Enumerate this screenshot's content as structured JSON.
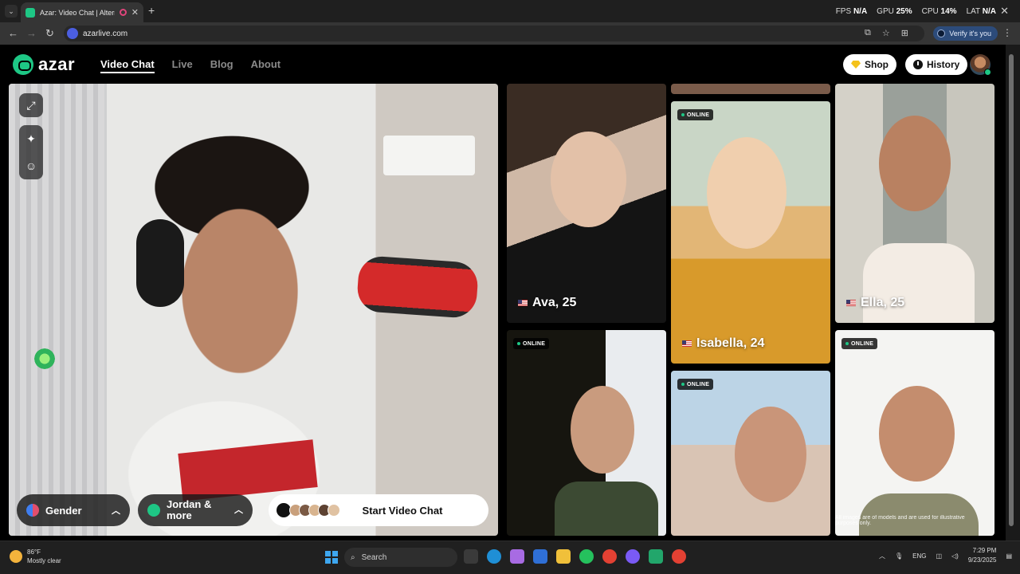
{
  "browser": {
    "tab_title": "Azar: Video Chat | Alternati",
    "url": "azarlive.com",
    "new_tab_symbol": "+",
    "verify_label": "Verify it's you",
    "perf": {
      "fps_label": "FPS",
      "fps_value": "N/A",
      "gpu_label": "GPU",
      "gpu_value": "25%",
      "cpu_label": "CPU",
      "cpu_value": "14%",
      "lat_label": "LAT",
      "lat_value": "N/A"
    }
  },
  "site": {
    "logo_text": "azar",
    "nav": [
      "Video Chat",
      "Live",
      "Blog",
      "About"
    ],
    "shop_label": "Shop",
    "history_label": "History"
  },
  "controls": {
    "gender_label": "Gender",
    "region_label": "Jordan & more",
    "start_label": "Start Video Chat"
  },
  "gallery": {
    "online_label": "ONLINE",
    "cards": [
      {
        "name": "Ava, 25",
        "online": false
      },
      {
        "name": "Isabella, 24",
        "online": true
      },
      {
        "name": "Ella, 25",
        "online": false
      },
      {
        "name": "",
        "online": true
      },
      {
        "name": "",
        "online": true
      },
      {
        "name": "",
        "online": true
      }
    ],
    "disclaimer": "All images are of models and are used for illustrative purposes only."
  },
  "taskbar": {
    "temp": "86°F",
    "weather": "Mostly clear",
    "search_placeholder": "Search",
    "lang": "ENG",
    "time": "7:29 PM",
    "date": "9/23/2025"
  },
  "colors": {
    "brand": "#1ec785",
    "background": "#000000",
    "mic_red": "#d42a2a"
  }
}
